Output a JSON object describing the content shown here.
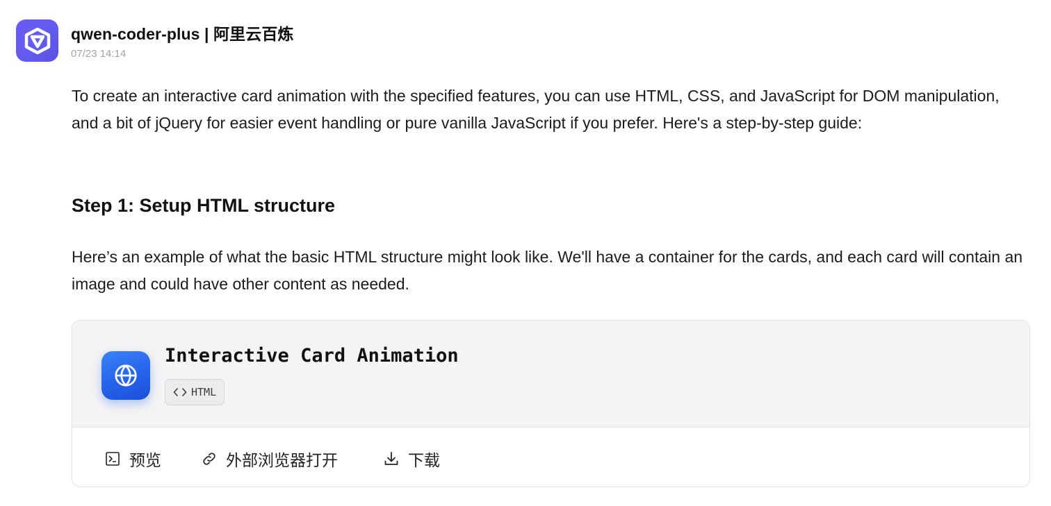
{
  "message": {
    "sender": "qwen-coder-plus | 阿里云百炼",
    "timestamp": "07/23 14:14",
    "avatar_icon": "qwen-logo-icon",
    "avatar_color": "#615ced"
  },
  "content": {
    "intro": "To create an interactive card animation with the specified features, you can use HTML, CSS, and JavaScript for DOM manipulation, and a bit of jQuery for easier event handling or pure vanilla JavaScript if you prefer. Here's a step-by-step guide:",
    "step_heading": "Step 1: Setup HTML structure",
    "step_paragraph": "Here’s an example of what the basic HTML structure might look like. We'll have a container for the cards, and each card will contain an image and could have other content as needed."
  },
  "artifact": {
    "title": "Interactive Card Animation",
    "language_badge": "HTML",
    "icon": "globe-icon",
    "icon_color": "#2563eb",
    "actions": {
      "preview": {
        "label": "预览",
        "icon": "terminal-icon"
      },
      "open_external": {
        "label": "外部浏览器打开",
        "icon": "link-icon"
      },
      "download": {
        "label": "下载",
        "icon": "download-icon"
      }
    }
  }
}
